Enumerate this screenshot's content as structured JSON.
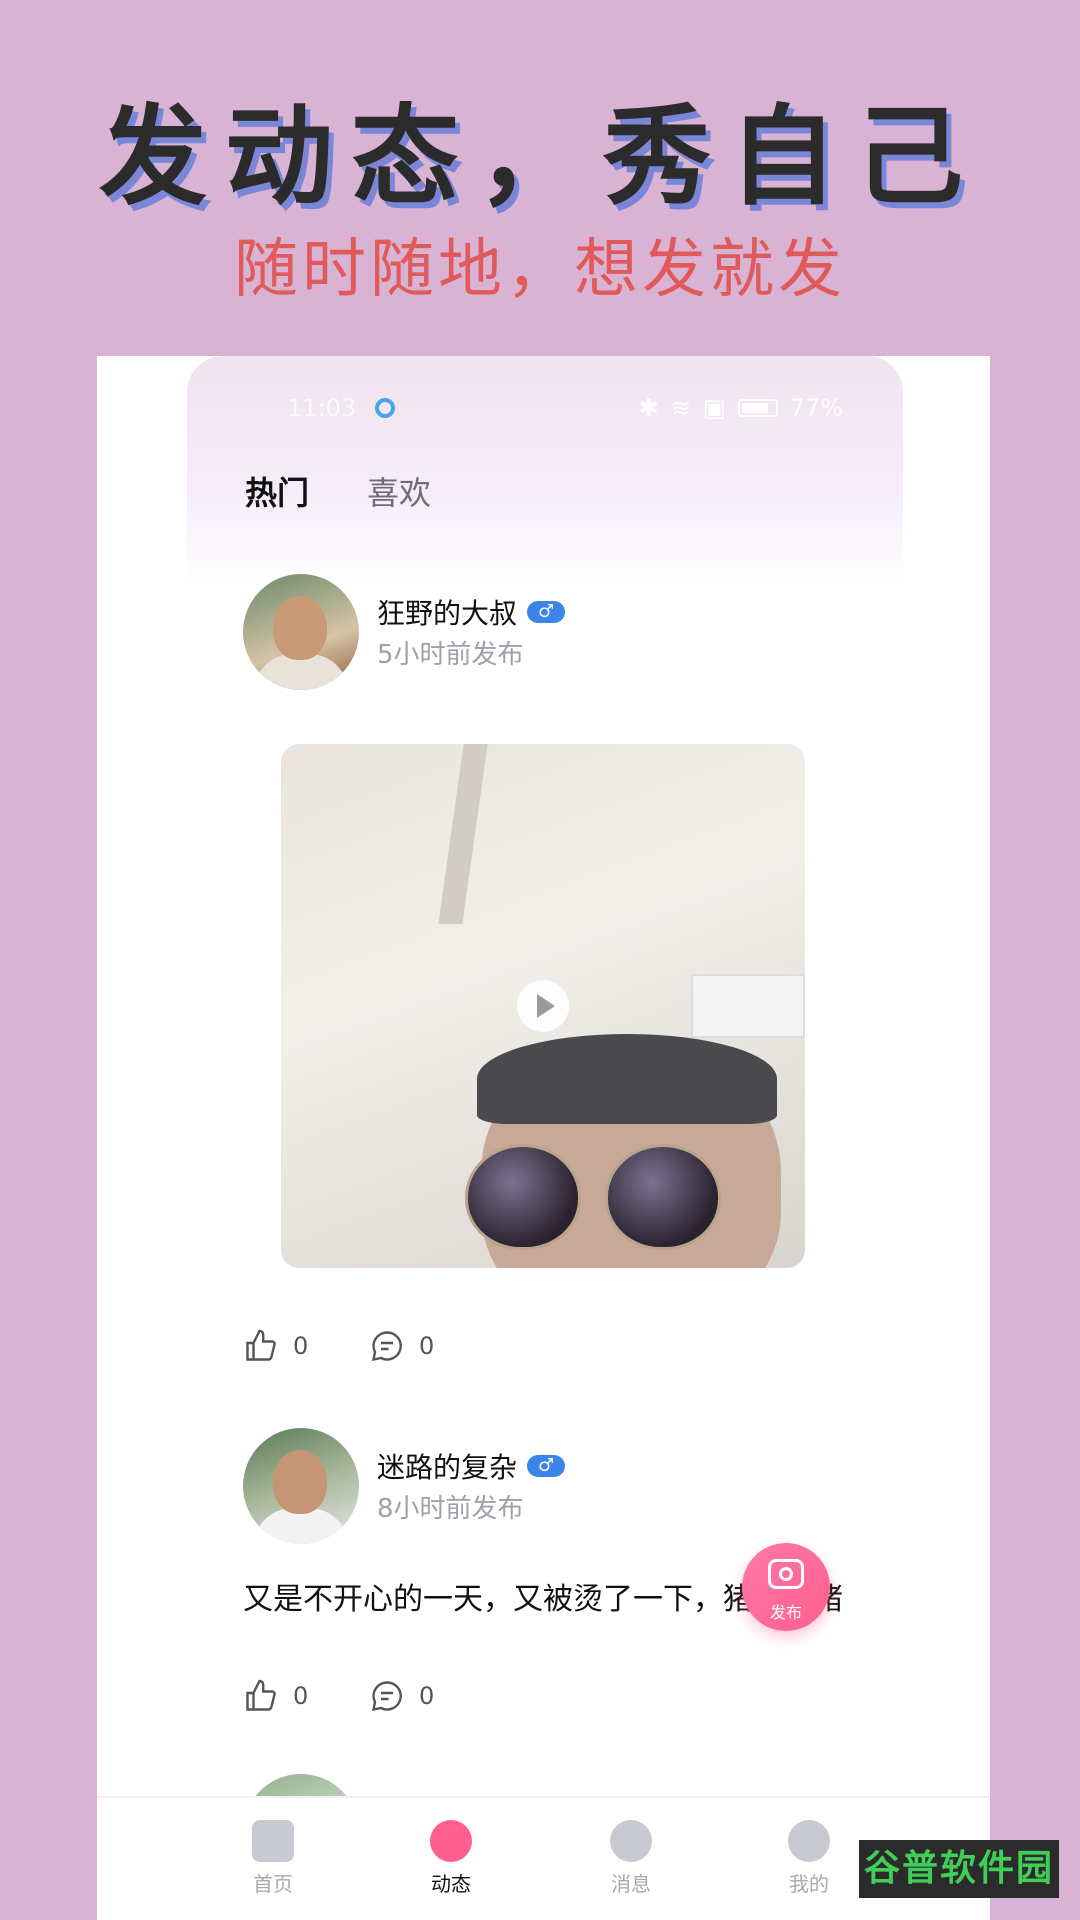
{
  "promo": {
    "headline": "发动态，秀自己",
    "subline": "随时随地，想发就发"
  },
  "status_bar": {
    "time": "11:03",
    "battery": "77%"
  },
  "tabs": [
    {
      "label": "热门",
      "active": true
    },
    {
      "label": "喜欢",
      "active": false
    }
  ],
  "posts": [
    {
      "username": "狂野的大叔",
      "gender": "♂",
      "time": "5小时前发布",
      "media_type": "video",
      "likes": "0",
      "comments": "0"
    },
    {
      "username": "迷路的复杂",
      "gender": "♂",
      "time": "8小时前发布",
      "text": "又是不开心的一天，又被烫了一下，猪就是猪",
      "likes": "0",
      "comments": "0"
    }
  ],
  "fab": {
    "label": "发布"
  },
  "bottom_nav": [
    {
      "label": "首页",
      "icon": "home-icon",
      "active": false
    },
    {
      "label": "动态",
      "icon": "compass-icon",
      "active": true
    },
    {
      "label": "消息",
      "icon": "message-icon",
      "active": false
    },
    {
      "label": "我的",
      "icon": "profile-icon",
      "active": false
    }
  ],
  "watermark": "谷普软件园",
  "colors": {
    "background": "#d9b3d3",
    "headline_shadow": "#7a86d8",
    "subline": "#e05a5a",
    "accent_pink": "#ff5e8e",
    "gender_badge": "#3a86e8"
  }
}
